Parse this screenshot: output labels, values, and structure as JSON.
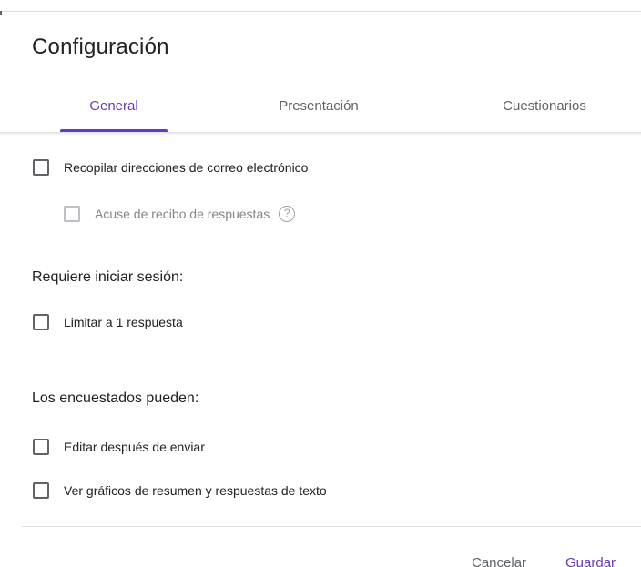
{
  "dialog": {
    "title": "Configuración"
  },
  "tabs": [
    {
      "label": "General",
      "active": true
    },
    {
      "label": "Presentación",
      "active": false
    },
    {
      "label": "Cuestionarios",
      "active": false
    }
  ],
  "options": {
    "collect_emails": {
      "label": "Recopilar direcciones de correo electrónico",
      "checked": false
    },
    "response_receipts": {
      "label": "Acuse de recibo de respuestas",
      "checked": false,
      "disabled": true
    }
  },
  "sign_in": {
    "heading": "Requiere iniciar sesión:",
    "limit_one": {
      "label": "Limitar a 1 respuesta",
      "checked": false
    }
  },
  "respondents": {
    "heading": "Los encuestados pueden:",
    "edit_after": {
      "label": "Editar después de enviar",
      "checked": false
    },
    "see_summary": {
      "label": "Ver gráficos de resumen y respuestas de texto",
      "checked": false
    }
  },
  "footer": {
    "cancel_label": "Cancelar",
    "save_label": "Guardar"
  },
  "colors": {
    "accent": "#673ab7",
    "text": "#202124",
    "secondary": "#5f6368"
  },
  "icons": {
    "help": "question-circle-icon"
  }
}
